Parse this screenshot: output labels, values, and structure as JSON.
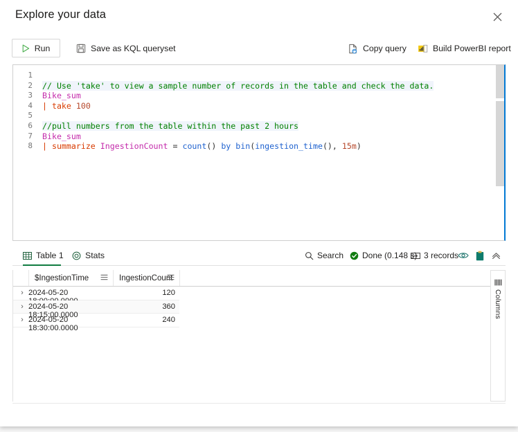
{
  "panel": {
    "title": "Explore your data",
    "close_label": "Close"
  },
  "toolbar": {
    "run_label": "Run",
    "save_label": "Save as KQL queryset",
    "copy_label": "Copy query",
    "powerbi_label": "Build PowerBI report"
  },
  "editor": {
    "language": "KQL",
    "line_numbers": [
      "1",
      "2",
      "3",
      "4",
      "5",
      "6",
      "7",
      "8"
    ],
    "lines": [
      {
        "n": "1",
        "text": ""
      },
      {
        "n": "2",
        "text": "// Use 'take' to view a sample number of records in the table and check the data."
      },
      {
        "n": "3",
        "text": "Bike_sum"
      },
      {
        "n": "4",
        "text": "| take 100"
      },
      {
        "n": "5",
        "text": ""
      },
      {
        "n": "6",
        "text": "//pull numbers from the table within the past 2 hours"
      },
      {
        "n": "7",
        "text": "Bike_sum"
      },
      {
        "n": "8",
        "text": "| summarize IngestionCount = count() by bin(ingestion_time(), 15m)"
      }
    ],
    "tokens": {
      "l2_comment": "// Use 'take' to view a sample number of records in the table and check the data.",
      "l3_table": "Bike_sum",
      "l4_pipe": "|",
      "l4_kw": "take",
      "l4_num": "100",
      "l6_comment": "//pull numbers from the table within the past 2 hours",
      "l7_table": "Bike_sum",
      "l8_pipe": "|",
      "l8_kw": "summarize",
      "l8_col": "IngestionCount",
      "l8_eq": "=",
      "l8_fn1": "count",
      "l8_paren1": "()",
      "l8_by": "by",
      "l8_fn2": "bin",
      "l8_open": "(",
      "l8_fn3": "ingestion_time",
      "l8_paren2": "()",
      "l8_comma": ", ",
      "l8_num": "15m",
      "l8_close": ")"
    }
  },
  "results": {
    "tabs": [
      {
        "label": "Table 1",
        "icon": "table-icon",
        "active": true
      },
      {
        "label": "Stats",
        "icon": "stats-icon",
        "active": false
      }
    ],
    "search_label": "Search",
    "status_label": "Done (0.148 s)",
    "records_label": "3 records",
    "eye_title": "Show/hide",
    "clipboard_title": "Copy to clipboard",
    "collapse_title": "Collapse",
    "columns_rail_label": "Columns"
  },
  "grid": {
    "columns": [
      {
        "name": "$IngestionTime",
        "align": "left"
      },
      {
        "name": "IngestionCount",
        "align": "right"
      }
    ],
    "rows": [
      {
        "ingestion_time": "2024-05-20 18:00:00.0000",
        "ingestion_count": "120"
      },
      {
        "ingestion_time": "2024-05-20 18:15:00.0000",
        "ingestion_count": "360"
      },
      {
        "ingestion_time": "2024-05-20 18:30:00.0000",
        "ingestion_count": "240"
      }
    ]
  },
  "colors": {
    "accent_green": "#107c41",
    "accent_blue": "#0078d4",
    "status_green": "#107c10",
    "comment_green": "#008000",
    "keyword_orange": "#d83b01",
    "identifier_magenta": "#c42bab",
    "function_blue": "#1f62cf",
    "clipboard_teal": "#0f7b6c"
  }
}
